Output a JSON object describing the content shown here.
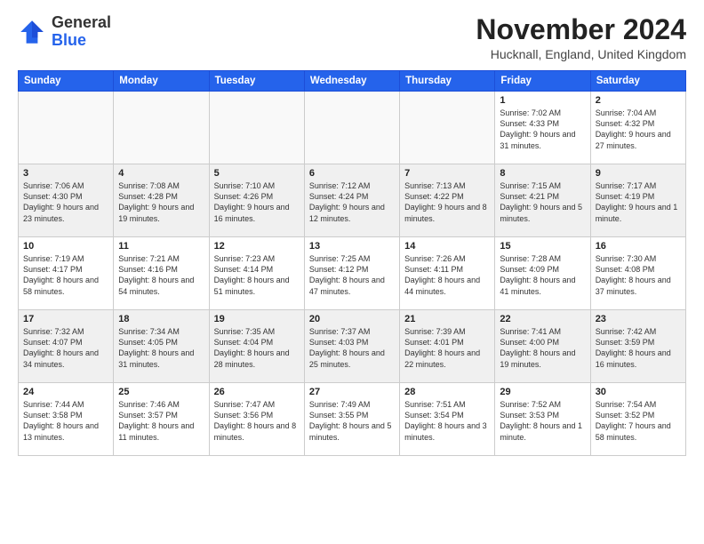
{
  "header": {
    "logo_general": "General",
    "logo_blue": "Blue",
    "month_title": "November 2024",
    "location": "Hucknall, England, United Kingdom"
  },
  "weekdays": [
    "Sunday",
    "Monday",
    "Tuesday",
    "Wednesday",
    "Thursday",
    "Friday",
    "Saturday"
  ],
  "weeks": [
    [
      {
        "day": "",
        "info": ""
      },
      {
        "day": "",
        "info": ""
      },
      {
        "day": "",
        "info": ""
      },
      {
        "day": "",
        "info": ""
      },
      {
        "day": "",
        "info": ""
      },
      {
        "day": "1",
        "info": "Sunrise: 7:02 AM\nSunset: 4:33 PM\nDaylight: 9 hours and 31 minutes."
      },
      {
        "day": "2",
        "info": "Sunrise: 7:04 AM\nSunset: 4:32 PM\nDaylight: 9 hours and 27 minutes."
      }
    ],
    [
      {
        "day": "3",
        "info": "Sunrise: 7:06 AM\nSunset: 4:30 PM\nDaylight: 9 hours and 23 minutes."
      },
      {
        "day": "4",
        "info": "Sunrise: 7:08 AM\nSunset: 4:28 PM\nDaylight: 9 hours and 19 minutes."
      },
      {
        "day": "5",
        "info": "Sunrise: 7:10 AM\nSunset: 4:26 PM\nDaylight: 9 hours and 16 minutes."
      },
      {
        "day": "6",
        "info": "Sunrise: 7:12 AM\nSunset: 4:24 PM\nDaylight: 9 hours and 12 minutes."
      },
      {
        "day": "7",
        "info": "Sunrise: 7:13 AM\nSunset: 4:22 PM\nDaylight: 9 hours and 8 minutes."
      },
      {
        "day": "8",
        "info": "Sunrise: 7:15 AM\nSunset: 4:21 PM\nDaylight: 9 hours and 5 minutes."
      },
      {
        "day": "9",
        "info": "Sunrise: 7:17 AM\nSunset: 4:19 PM\nDaylight: 9 hours and 1 minute."
      }
    ],
    [
      {
        "day": "10",
        "info": "Sunrise: 7:19 AM\nSunset: 4:17 PM\nDaylight: 8 hours and 58 minutes."
      },
      {
        "day": "11",
        "info": "Sunrise: 7:21 AM\nSunset: 4:16 PM\nDaylight: 8 hours and 54 minutes."
      },
      {
        "day": "12",
        "info": "Sunrise: 7:23 AM\nSunset: 4:14 PM\nDaylight: 8 hours and 51 minutes."
      },
      {
        "day": "13",
        "info": "Sunrise: 7:25 AM\nSunset: 4:12 PM\nDaylight: 8 hours and 47 minutes."
      },
      {
        "day": "14",
        "info": "Sunrise: 7:26 AM\nSunset: 4:11 PM\nDaylight: 8 hours and 44 minutes."
      },
      {
        "day": "15",
        "info": "Sunrise: 7:28 AM\nSunset: 4:09 PM\nDaylight: 8 hours and 41 minutes."
      },
      {
        "day": "16",
        "info": "Sunrise: 7:30 AM\nSunset: 4:08 PM\nDaylight: 8 hours and 37 minutes."
      }
    ],
    [
      {
        "day": "17",
        "info": "Sunrise: 7:32 AM\nSunset: 4:07 PM\nDaylight: 8 hours and 34 minutes."
      },
      {
        "day": "18",
        "info": "Sunrise: 7:34 AM\nSunset: 4:05 PM\nDaylight: 8 hours and 31 minutes."
      },
      {
        "day": "19",
        "info": "Sunrise: 7:35 AM\nSunset: 4:04 PM\nDaylight: 8 hours and 28 minutes."
      },
      {
        "day": "20",
        "info": "Sunrise: 7:37 AM\nSunset: 4:03 PM\nDaylight: 8 hours and 25 minutes."
      },
      {
        "day": "21",
        "info": "Sunrise: 7:39 AM\nSunset: 4:01 PM\nDaylight: 8 hours and 22 minutes."
      },
      {
        "day": "22",
        "info": "Sunrise: 7:41 AM\nSunset: 4:00 PM\nDaylight: 8 hours and 19 minutes."
      },
      {
        "day": "23",
        "info": "Sunrise: 7:42 AM\nSunset: 3:59 PM\nDaylight: 8 hours and 16 minutes."
      }
    ],
    [
      {
        "day": "24",
        "info": "Sunrise: 7:44 AM\nSunset: 3:58 PM\nDaylight: 8 hours and 13 minutes."
      },
      {
        "day": "25",
        "info": "Sunrise: 7:46 AM\nSunset: 3:57 PM\nDaylight: 8 hours and 11 minutes."
      },
      {
        "day": "26",
        "info": "Sunrise: 7:47 AM\nSunset: 3:56 PM\nDaylight: 8 hours and 8 minutes."
      },
      {
        "day": "27",
        "info": "Sunrise: 7:49 AM\nSunset: 3:55 PM\nDaylight: 8 hours and 5 minutes."
      },
      {
        "day": "28",
        "info": "Sunrise: 7:51 AM\nSunset: 3:54 PM\nDaylight: 8 hours and 3 minutes."
      },
      {
        "day": "29",
        "info": "Sunrise: 7:52 AM\nSunset: 3:53 PM\nDaylight: 8 hours and 1 minute."
      },
      {
        "day": "30",
        "info": "Sunrise: 7:54 AM\nSunset: 3:52 PM\nDaylight: 7 hours and 58 minutes."
      }
    ]
  ]
}
